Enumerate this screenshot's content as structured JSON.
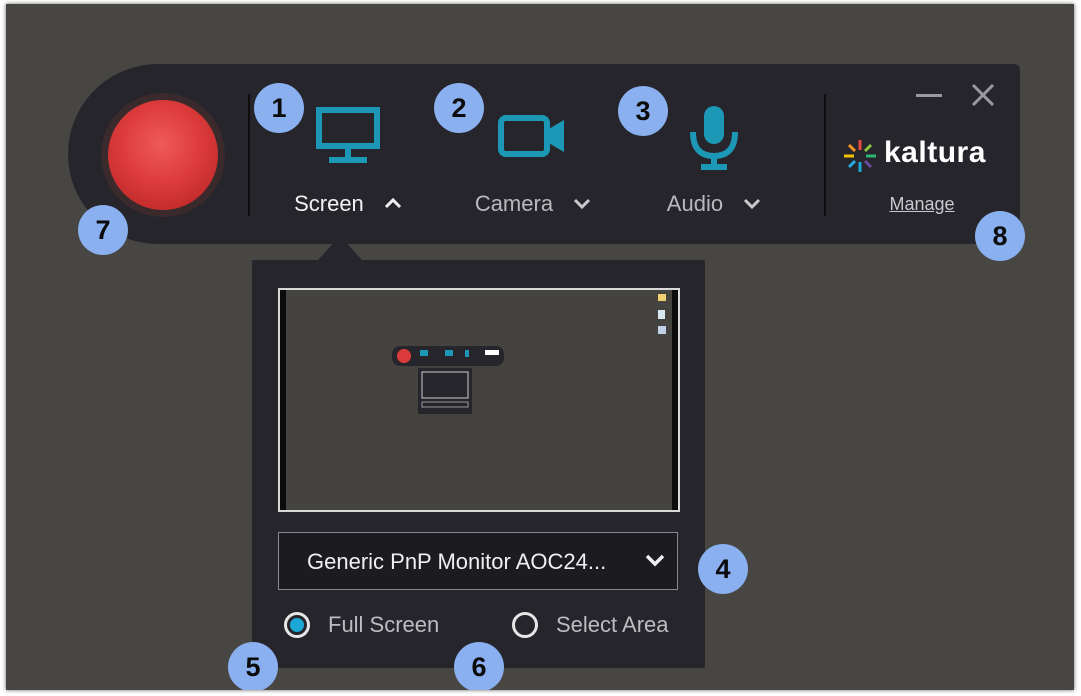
{
  "toolbar": {
    "sources": [
      {
        "label": "Screen",
        "icon": "monitor-icon",
        "state": "expanded"
      },
      {
        "label": "Camera",
        "icon": "camera-icon",
        "state": "collapsed"
      },
      {
        "label": "Audio",
        "icon": "microphone-icon",
        "state": "collapsed"
      }
    ],
    "brand": "kaltura",
    "manage_label": "Manage"
  },
  "screen_panel": {
    "monitor_value": "Generic PnP Monitor AOC24...",
    "options": [
      {
        "label": "Full Screen",
        "selected": true
      },
      {
        "label": "Select Area",
        "selected": false
      }
    ]
  },
  "callouts": [
    "1",
    "2",
    "3",
    "4",
    "5",
    "6",
    "7",
    "8"
  ],
  "colors": {
    "accent": "#1ca7d6",
    "record": "#dc3b3b",
    "toolbar_bg": "#26252b",
    "callout": "#8ab0f0"
  }
}
